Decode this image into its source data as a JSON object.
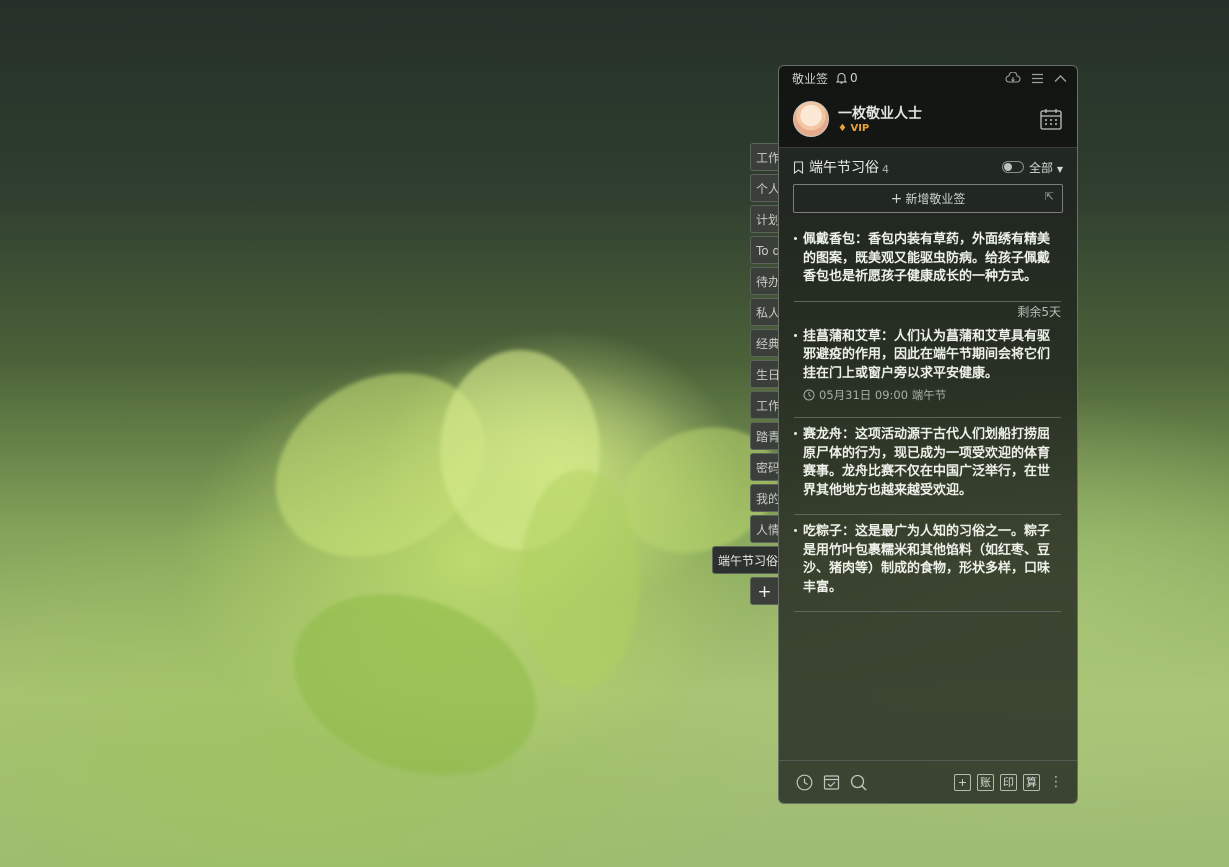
{
  "app": {
    "name": "敬业签",
    "notification_count": "0"
  },
  "user": {
    "name": "一枚敬业人士",
    "badge": "VIP"
  },
  "tabs": [
    {
      "label": "工作"
    },
    {
      "label": "个人"
    },
    {
      "label": "计划"
    },
    {
      "label": "To do"
    },
    {
      "label": "待办"
    },
    {
      "label": "私人"
    },
    {
      "label": "经典"
    },
    {
      "label": "生日"
    },
    {
      "label": "工作"
    },
    {
      "label": "踏青"
    },
    {
      "label": "密码"
    },
    {
      "label": "我的"
    },
    {
      "label": "人情"
    },
    {
      "label": "端午节习俗",
      "active": true
    },
    {
      "label": "+"
    }
  ],
  "list": {
    "title": "端午节习俗",
    "count": "4",
    "filter": "全部",
    "add_label": "新增敬业签"
  },
  "notes": [
    {
      "text": "佩戴香包：香包内装有草药，外面绣有精美的图案，既美观又能驱虫防病。给孩子佩戴香包也是祈愿孩子健康成长的一种方式。"
    },
    {
      "text": "挂菖蒲和艾草：人们认为菖蒲和艾草具有驱邪避疫的作用，因此在端午节期间会将它们挂在门上或窗户旁以求平安健康。",
      "remaining": "剩余5天",
      "reminder": "05月31日 09:00 端午节"
    },
    {
      "text": "赛龙舟：这项活动源于古代人们划船打捞屈原尸体的行为，现已成为一项受欢迎的体育赛事。龙舟比赛不仅在中国广泛举行，在世界其他地方也越来越受欢迎。"
    },
    {
      "text": "吃粽子：这是最广为人知的习俗之一。粽子是用竹叶包裹糯米和其他馅料（如红枣、豆沙、猪肉等）制成的食物，形状多样，口味丰富。"
    }
  ],
  "footer": {
    "btn_add": "+",
    "btn_account": "账",
    "btn_print": "印",
    "btn_calc": "算"
  },
  "colors": {
    "vip": "#e9a23a",
    "panel_bg": "#1e211e"
  }
}
